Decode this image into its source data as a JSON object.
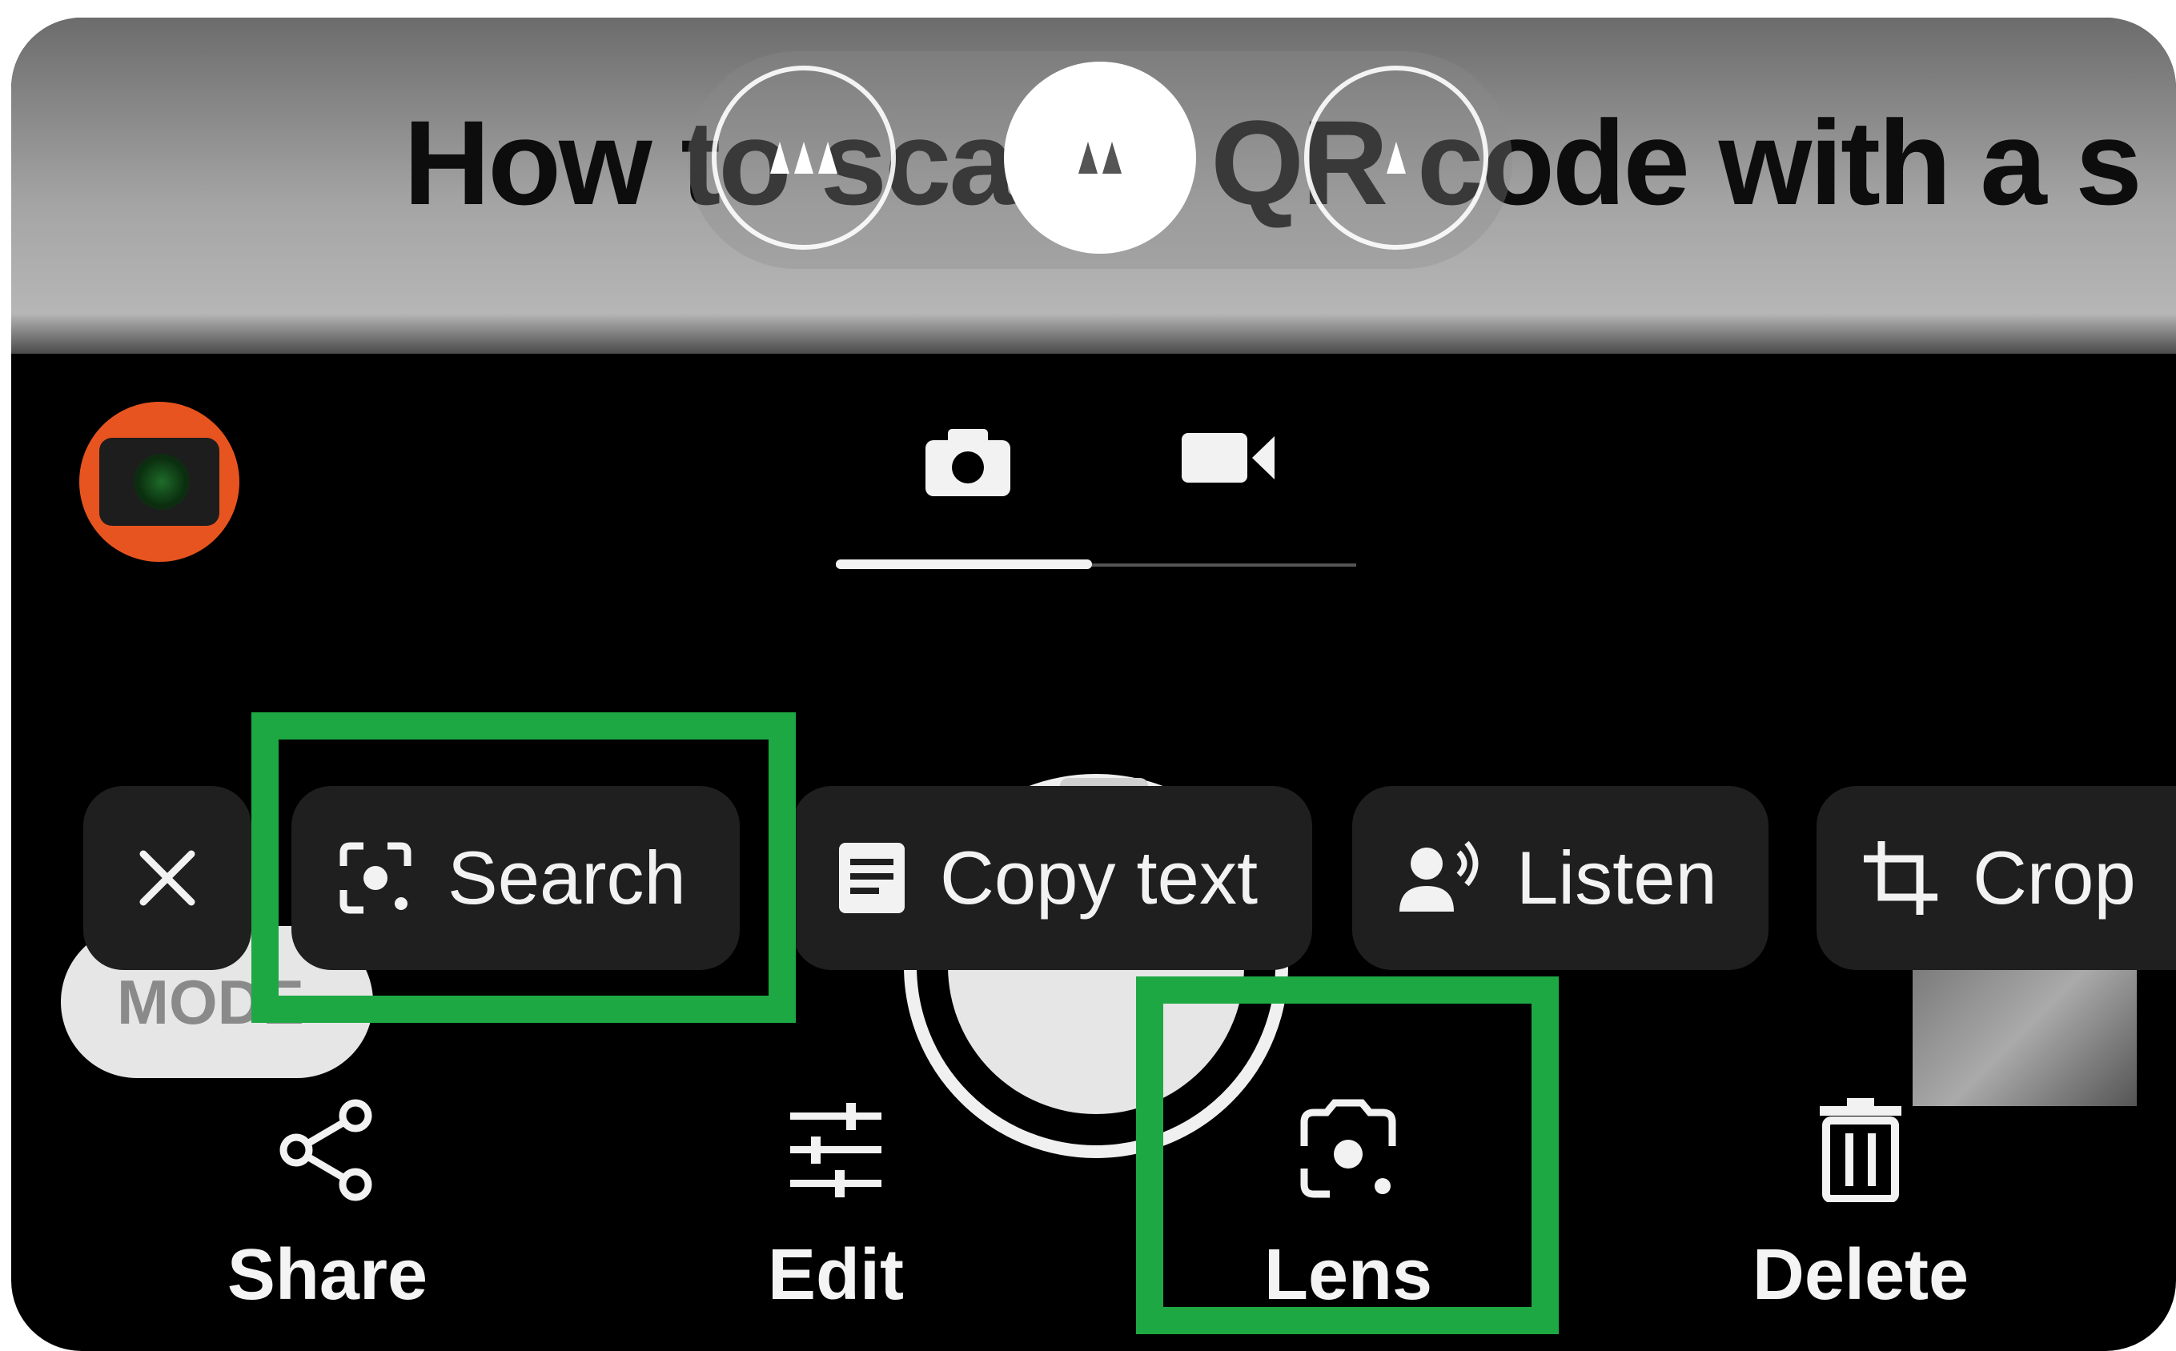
{
  "preview": {
    "title": "How to scan a QR code with a s"
  },
  "mode_pill": {
    "label": "MODE"
  },
  "chips": {
    "close_label": "×",
    "search_label": "Search",
    "copy_text_label": "Copy text",
    "listen_label": "Listen",
    "crop_label": "Crop"
  },
  "actions": {
    "share_label": "Share",
    "edit_label": "Edit",
    "lens_label": "Lens",
    "delete_label": "Delete"
  },
  "colors": {
    "highlight": "#1ea843",
    "mode_icon": "#e8541f",
    "chip_bg": "#1f1f1f"
  },
  "icons": [
    "camera-icon",
    "video-icon",
    "close-icon",
    "lens-search-icon",
    "copy-text-icon",
    "listen-icon",
    "crop-icon",
    "share-icon",
    "edit-sliders-icon",
    "lens-icon",
    "delete-icon"
  ]
}
